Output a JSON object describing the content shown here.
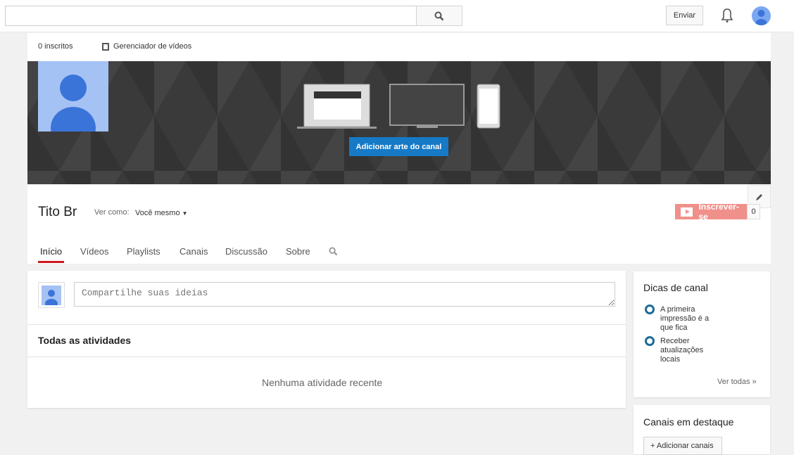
{
  "topbar": {
    "search_placeholder": "",
    "upload_label": "Enviar"
  },
  "header": {
    "subscribers": "0 inscritos",
    "video_manager": "Gerenciador de vídeos",
    "add_art": "Adicionar arte do canal",
    "channel_name": "Tito Br",
    "view_as_label": "Ver como:",
    "view_as_value": "Você mesmo",
    "subscribe_label": "Inscrever-se",
    "subscribe_count": "0"
  },
  "tabs": [
    "Início",
    "Vídeos",
    "Playlists",
    "Canais",
    "Discussão",
    "Sobre"
  ],
  "feed": {
    "share_placeholder": "Compartilhe suas ideias",
    "section_title": "Todas as atividades",
    "empty": "Nenhuma atividade recente"
  },
  "tips": {
    "title": "Dicas de canal",
    "items": [
      "A primeira impressão é a que fica",
      "Receber atualizações locais"
    ],
    "see_all": "Ver todas »"
  },
  "featured": {
    "title": "Canais em destaque",
    "add_label": "+ Adicionar canais"
  },
  "colors": {
    "accent": "#167ac6",
    "subscribe": "#f0908a",
    "active_tab": "#cc181e"
  }
}
